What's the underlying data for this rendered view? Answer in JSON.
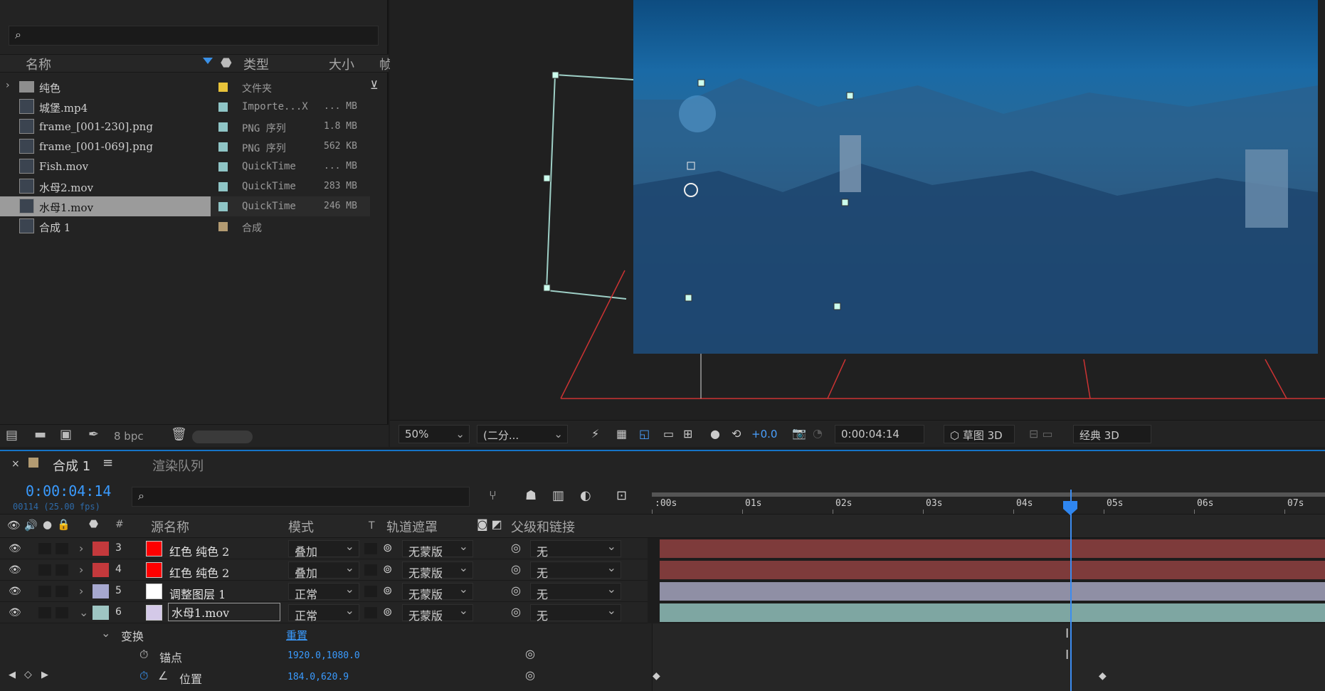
{
  "project": {
    "search_placeholder": "",
    "columns": {
      "name": "名称",
      "type": "类型",
      "size": "大小",
      "frame": "帧"
    },
    "items": [
      {
        "name": "纯色",
        "type": "文件夹",
        "size": "",
        "label_color": "#e8c33a",
        "icon": "folder-icon"
      },
      {
        "name": "城堡.mp4",
        "type": "Importe...X",
        "size": "... MB",
        "label_color": "#8fc5c6",
        "icon": "video-file-icon"
      },
      {
        "name": "frame_[001-230].png",
        "type": "PNG 序列",
        "size": "1.8 MB",
        "label_color": "#8fc5c6",
        "icon": "image-sequence-icon"
      },
      {
        "name": "frame_[001-069].png",
        "type": "PNG 序列",
        "size": "562 KB",
        "label_color": "#8fc5c6",
        "icon": "image-sequence-icon"
      },
      {
        "name": "Fish.mov",
        "type": "QuickTime",
        "size": "... MB",
        "label_color": "#8fc5c6",
        "icon": "quicktime-file-icon"
      },
      {
        "name": "水母2.mov",
        "type": "QuickTime",
        "size": "283 MB",
        "label_color": "#8fc5c6",
        "icon": "quicktime-file-icon"
      },
      {
        "name": "水母1.mov",
        "type": "QuickTime",
        "size": "246 MB",
        "label_color": "#8fc5c6",
        "icon": "quicktime-file-icon",
        "selected": true
      },
      {
        "name": "合成 1",
        "type": "合成",
        "size": "",
        "label_color": "#b39b72",
        "icon": "composition-icon"
      }
    ],
    "bpc": "8 bpc"
  },
  "viewer": {
    "zoom": "50%",
    "resolution": "(二分...",
    "exposure": "+0.0",
    "timecode": "0:00:04:14",
    "renderer": "草图 3D",
    "workspace": "经典 3D"
  },
  "timeline": {
    "tab_comp": "合成 1",
    "tab_render": "渲染队列",
    "current_time": "0:00:04:14",
    "frame_info": "00114 (25.00 fps)",
    "search_placeholder": "",
    "columns": {
      "num": "#",
      "source": "源名称",
      "mode": "模式",
      "t": "T",
      "matte": "轨道遮罩",
      "parent": "父级和链接"
    },
    "ruler": [
      ":00s",
      "01s",
      "02s",
      "03s",
      "04s",
      "05s",
      "06s",
      "07s"
    ],
    "marker": "1",
    "layers": [
      {
        "num": "3",
        "name": "红色 纯色 2",
        "mode": "叠加",
        "matte": "无蒙版",
        "parent": "无",
        "label_color": "#c4393c",
        "swatch": "#ff0000",
        "bar_color": "#7e3b3b"
      },
      {
        "num": "4",
        "name": "红色 纯色 2",
        "mode": "叠加",
        "matte": "无蒙版",
        "parent": "无",
        "label_color": "#c4393c",
        "swatch": "#ff0000",
        "bar_color": "#7e3b3b"
      },
      {
        "num": "5",
        "name": "调整图层 1",
        "mode": "正常",
        "matte": "无蒙版",
        "parent": "无",
        "label_color": "#a6a8cf",
        "swatch": "#ffffff",
        "bar_color": "#8f8fa5"
      },
      {
        "num": "6",
        "name": "水母1.mov",
        "mode": "正常",
        "matte": "无蒙版",
        "parent": "无",
        "label_color": "#9ec5c2",
        "swatch": "#d4c9e8",
        "bar_color": "#7ea6a2"
      }
    ],
    "transform": {
      "label": "变换",
      "reset": "重置",
      "anchor_label": "锚点",
      "anchor_value": "1920.0,1080.0",
      "position_label": "位置",
      "position_value": "184.0,620.9"
    }
  }
}
